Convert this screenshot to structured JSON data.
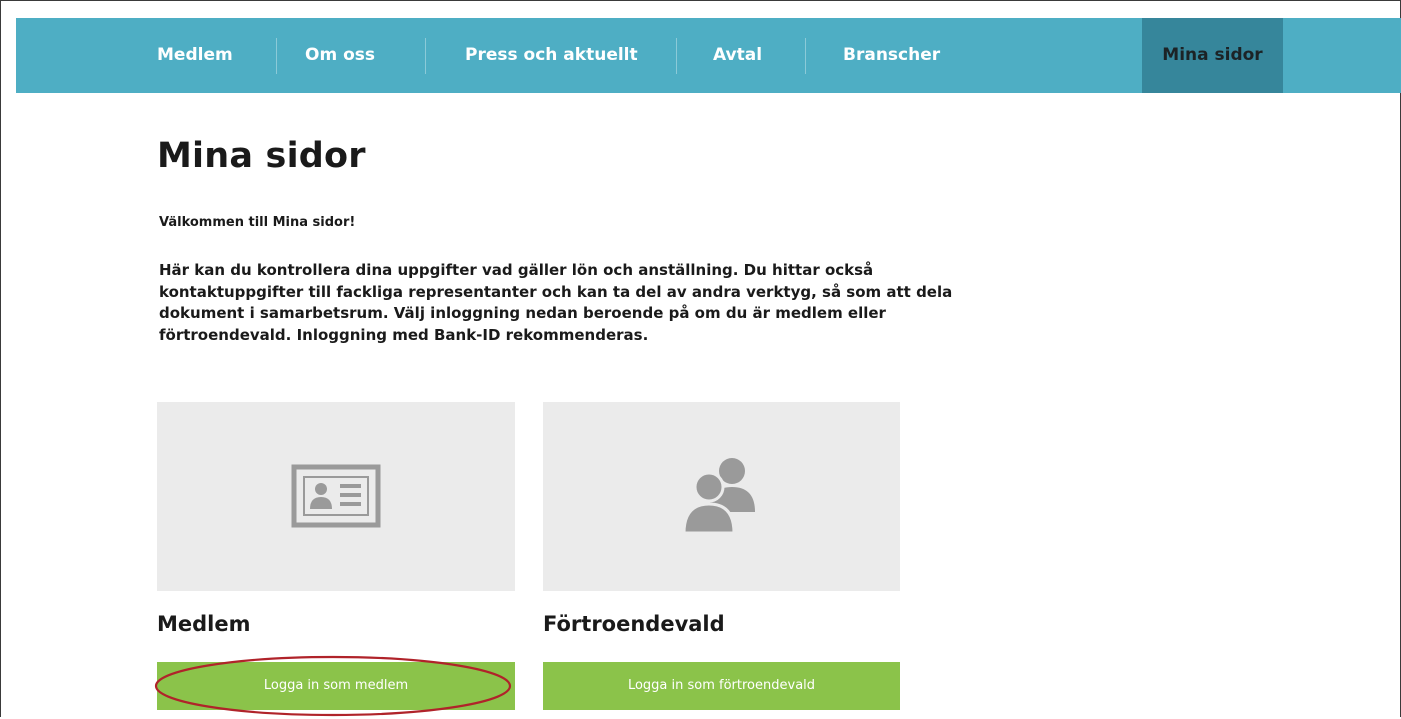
{
  "nav": {
    "items": [
      {
        "label": "Medlem"
      },
      {
        "label": "Om oss"
      },
      {
        "label": "Press och aktuellt"
      },
      {
        "label": "Avtal"
      },
      {
        "label": "Branscher"
      }
    ],
    "active_label": "Mina sidor",
    "color": "#4eaec4",
    "active_color": "#36869b"
  },
  "page": {
    "title": "Mina sidor",
    "welcome": "Välkommen till Mina sidor!",
    "intro": "Här kan du kontrollera dina uppgifter vad gäller lön och anställning. Du hittar också kontaktuppgifter till fackliga representanter och kan ta del av andra verktyg, så som att dela dokument i samarbetsrum. Välj inloggning nedan beroende på om du är medlem eller förtroendevald. Inloggning med Bank-ID rekommenderas."
  },
  "cards": [
    {
      "title": "Medlem",
      "button_label": "Logga in som medlem",
      "icon": "id-card-icon"
    },
    {
      "title": "Förtroendevald",
      "button_label": "Logga in som förtroendevald",
      "icon": "users-icon"
    }
  ],
  "colors": {
    "button": "#8bc34a",
    "card_bg": "#ebebeb",
    "icon": "#9a9a9a",
    "highlight": "#b0232a"
  }
}
